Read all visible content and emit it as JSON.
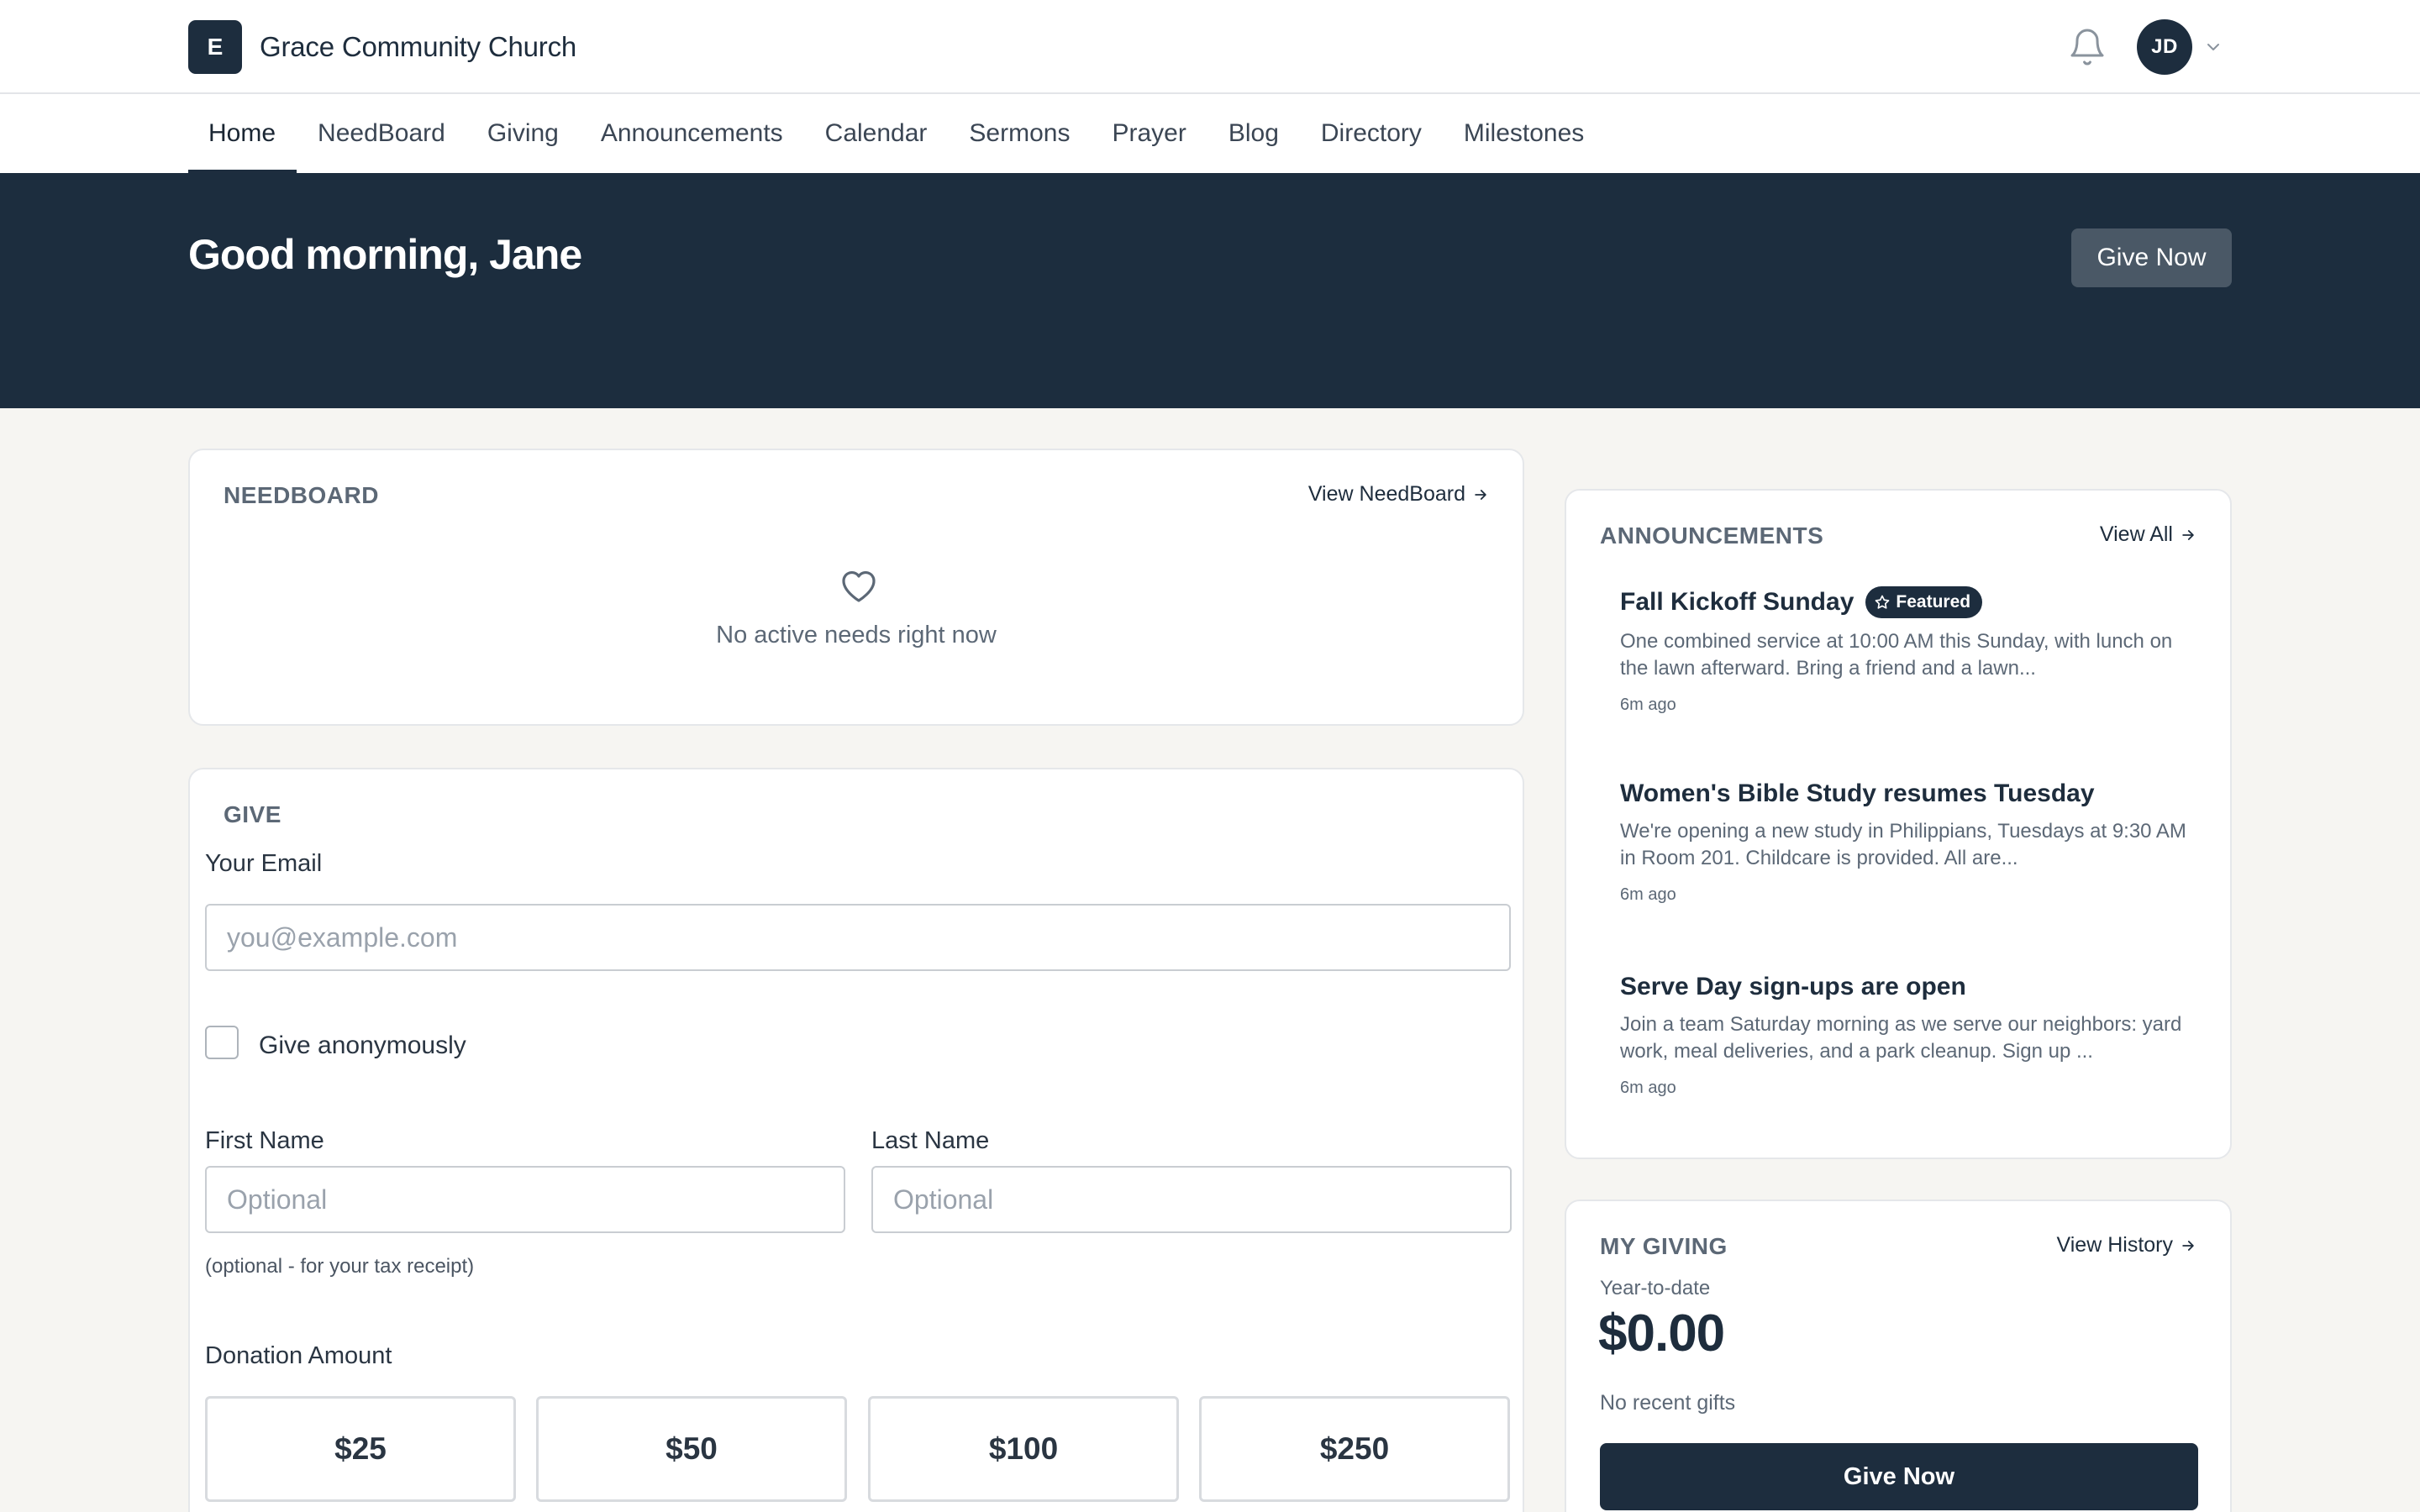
{
  "header": {
    "logo_letter": "E",
    "church_name": "Grace Community Church",
    "avatar_initials": "JD"
  },
  "nav": {
    "items": [
      {
        "label": "Home",
        "active": true
      },
      {
        "label": "NeedBoard"
      },
      {
        "label": "Giving"
      },
      {
        "label": "Announcements"
      },
      {
        "label": "Calendar"
      },
      {
        "label": "Sermons"
      },
      {
        "label": "Prayer"
      },
      {
        "label": "Blog"
      },
      {
        "label": "Directory"
      },
      {
        "label": "Milestones"
      }
    ]
  },
  "hero": {
    "greeting": "Good morning, Jane",
    "give_now_label": "Give Now"
  },
  "needboard": {
    "title": "NEEDBOARD",
    "link_label": "View NeedBoard",
    "empty_text": "No active needs right now"
  },
  "give": {
    "title": "GIVE",
    "email_label": "Your Email",
    "email_placeholder": "you@example.com",
    "anonymous_label": "Give anonymously",
    "first_name_label": "First Name",
    "first_name_placeholder": "Optional",
    "last_name_label": "Last Name",
    "last_name_placeholder": "Optional",
    "hint": "(optional - for your tax receipt)",
    "amount_label": "Donation Amount",
    "amounts": [
      "$25",
      "$50",
      "$100",
      "$250"
    ]
  },
  "announcements": {
    "title": "ANNOUNCEMENTS",
    "link_label": "View All",
    "items": [
      {
        "title": "Fall Kickoff Sunday",
        "badge": "Featured",
        "body": "One combined service at 10:00 AM this Sunday, with lunch on the lawn afterward. Bring a friend and a lawn...",
        "time": "6m ago"
      },
      {
        "title": "Women's Bible Study resumes Tuesday",
        "body": "We're opening a new study in Philippians, Tuesdays at 9:30 AM in Room 201. Childcare is provided. All are...",
        "time": "6m ago"
      },
      {
        "title": "Serve Day sign-ups are open",
        "body": "Join a team Saturday morning as we serve our neighbors: yard work, meal deliveries, and a park cleanup. Sign up ...",
        "time": "6m ago"
      }
    ]
  },
  "my_giving": {
    "title": "MY GIVING",
    "link_label": "View History",
    "ytd_label": "Year-to-date",
    "ytd_amount": "$0.00",
    "recent_text": "No recent gifts",
    "give_now_label": "Give Now"
  },
  "colors": {
    "primary": "#1d2d3e",
    "background": "#f6f5f2",
    "hero_button": "#4a5866"
  }
}
